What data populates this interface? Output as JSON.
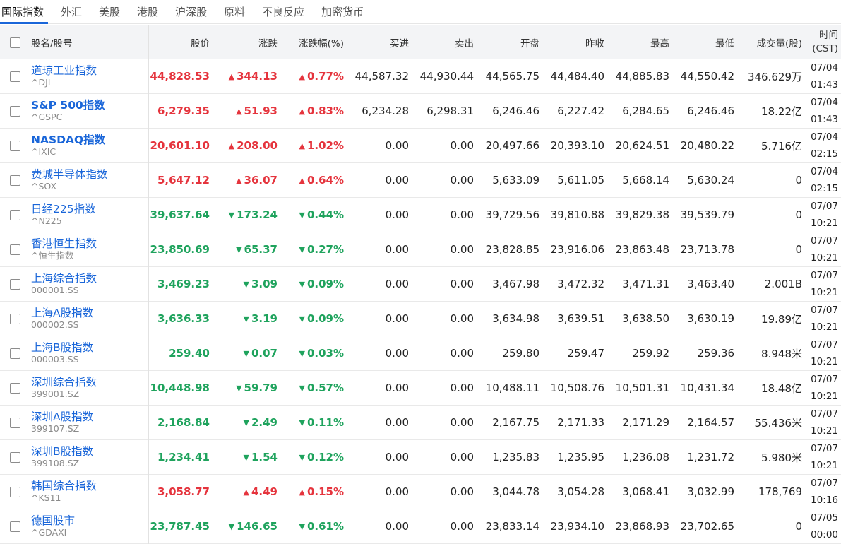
{
  "tabs": [
    {
      "label": "国际指数",
      "active": true
    },
    {
      "label": "外汇",
      "active": false
    },
    {
      "label": "美股",
      "active": false
    },
    {
      "label": "港股",
      "active": false
    },
    {
      "label": "沪深股",
      "active": false
    },
    {
      "label": "原料",
      "active": false
    },
    {
      "label": "不良反应",
      "active": false
    },
    {
      "label": "加密货币",
      "active": false
    }
  ],
  "columns": {
    "name": "股名/股号",
    "price": "股价",
    "change": "涨跌",
    "pct": "涨跌幅(%)",
    "bid": "买进",
    "ask": "卖出",
    "open": "开盘",
    "prev": "昨收",
    "high": "最高",
    "low": "最低",
    "volume": "成交量(股)",
    "time_line1": "时间",
    "time_line2": "(CST)"
  },
  "colors": {
    "up": "#e5343d",
    "down": "#1fa35d",
    "link": "#1a66d9"
  },
  "rows": [
    {
      "name": "道琼工业指数",
      "code": "^DJI",
      "bold": false,
      "dir": "up",
      "price": "44,828.53",
      "change": "344.13",
      "pct": "0.77%",
      "bid": "44,587.32",
      "ask": "44,930.44",
      "open": "44,565.75",
      "prev": "44,484.40",
      "high": "44,885.83",
      "low": "44,550.42",
      "volume": "346.629万",
      "date": "07/04",
      "time": "01:43"
    },
    {
      "name": "S&P 500指数",
      "code": "^GSPC",
      "bold": true,
      "dir": "up",
      "price": "6,279.35",
      "change": "51.93",
      "pct": "0.83%",
      "bid": "6,234.28",
      "ask": "6,298.31",
      "open": "6,246.46",
      "prev": "6,227.42",
      "high": "6,284.65",
      "low": "6,246.46",
      "volume": "18.22亿",
      "date": "07/04",
      "time": "01:43"
    },
    {
      "name": "NASDAQ指数",
      "code": "^IXIC",
      "bold": true,
      "dir": "up",
      "price": "20,601.10",
      "change": "208.00",
      "pct": "1.02%",
      "bid": "0.00",
      "ask": "0.00",
      "open": "20,497.66",
      "prev": "20,393.10",
      "high": "20,624.51",
      "low": "20,480.22",
      "volume": "5.716亿",
      "date": "07/04",
      "time": "02:15"
    },
    {
      "name": "费城半导体指数",
      "code": "^SOX",
      "bold": false,
      "dir": "up",
      "price": "5,647.12",
      "change": "36.07",
      "pct": "0.64%",
      "bid": "0.00",
      "ask": "0.00",
      "open": "5,633.09",
      "prev": "5,611.05",
      "high": "5,668.14",
      "low": "5,630.24",
      "volume": "0",
      "date": "07/04",
      "time": "02:15"
    },
    {
      "name": "日经225指数",
      "code": "^N225",
      "bold": false,
      "dir": "down",
      "price": "39,637.64",
      "change": "173.24",
      "pct": "0.44%",
      "bid": "0.00",
      "ask": "0.00",
      "open": "39,729.56",
      "prev": "39,810.88",
      "high": "39,829.38",
      "low": "39,539.79",
      "volume": "0",
      "date": "07/07",
      "time": "10:21"
    },
    {
      "name": "香港恒生指数",
      "code": "^恒生指数",
      "bold": false,
      "dir": "down",
      "price": "23,850.69",
      "change": "65.37",
      "pct": "0.27%",
      "bid": "0.00",
      "ask": "0.00",
      "open": "23,828.85",
      "prev": "23,916.06",
      "high": "23,863.48",
      "low": "23,713.78",
      "volume": "0",
      "date": "07/07",
      "time": "10:21"
    },
    {
      "name": "上海综合指数",
      "code": "000001.SS",
      "bold": false,
      "dir": "down",
      "price": "3,469.23",
      "change": "3.09",
      "pct": "0.09%",
      "bid": "0.00",
      "ask": "0.00",
      "open": "3,467.98",
      "prev": "3,472.32",
      "high": "3,471.31",
      "low": "3,463.40",
      "volume": "2.001B",
      "date": "07/07",
      "time": "10:21"
    },
    {
      "name": "上海A股指数",
      "code": "000002.SS",
      "bold": false,
      "dir": "down",
      "price": "3,636.33",
      "change": "3.19",
      "pct": "0.09%",
      "bid": "0.00",
      "ask": "0.00",
      "open": "3,634.98",
      "prev": "3,639.51",
      "high": "3,638.50",
      "low": "3,630.19",
      "volume": "19.89亿",
      "date": "07/07",
      "time": "10:21"
    },
    {
      "name": "上海B股指数",
      "code": "000003.SS",
      "bold": false,
      "dir": "down",
      "price": "259.40",
      "change": "0.07",
      "pct": "0.03%",
      "bid": "0.00",
      "ask": "0.00",
      "open": "259.80",
      "prev": "259.47",
      "high": "259.92",
      "low": "259.36",
      "volume": "8.948米",
      "date": "07/07",
      "time": "10:21"
    },
    {
      "name": "深圳综合指数",
      "code": "399001.SZ",
      "bold": false,
      "dir": "down",
      "price": "10,448.98",
      "change": "59.79",
      "pct": "0.57%",
      "bid": "0.00",
      "ask": "0.00",
      "open": "10,488.11",
      "prev": "10,508.76",
      "high": "10,501.31",
      "low": "10,431.34",
      "volume": "18.48亿",
      "date": "07/07",
      "time": "10:21"
    },
    {
      "name": "深圳A股指数",
      "code": "399107.SZ",
      "bold": false,
      "dir": "down",
      "price": "2,168.84",
      "change": "2.49",
      "pct": "0.11%",
      "bid": "0.00",
      "ask": "0.00",
      "open": "2,167.75",
      "prev": "2,171.33",
      "high": "2,171.29",
      "low": "2,164.57",
      "volume": "55.436米",
      "date": "07/07",
      "time": "10:21"
    },
    {
      "name": "深圳B股指数",
      "code": "399108.SZ",
      "bold": false,
      "dir": "down",
      "price": "1,234.41",
      "change": "1.54",
      "pct": "0.12%",
      "bid": "0.00",
      "ask": "0.00",
      "open": "1,235.83",
      "prev": "1,235.95",
      "high": "1,236.08",
      "low": "1,231.72",
      "volume": "5.980米",
      "date": "07/07",
      "time": "10:21"
    },
    {
      "name": "韩国综合指数",
      "code": "^KS11",
      "bold": false,
      "dir": "up",
      "price": "3,058.77",
      "change": "4.49",
      "pct": "0.15%",
      "bid": "0.00",
      "ask": "0.00",
      "open": "3,044.78",
      "prev": "3,054.28",
      "high": "3,068.41",
      "low": "3,032.99",
      "volume": "178,769",
      "date": "07/07",
      "time": "10:16"
    },
    {
      "name": "德国股市",
      "code": "^GDAXI",
      "bold": false,
      "dir": "down",
      "price": "23,787.45",
      "change": "146.65",
      "pct": "0.61%",
      "bid": "0.00",
      "ask": "0.00",
      "open": "23,833.14",
      "prev": "23,934.10",
      "high": "23,868.93",
      "low": "23,702.65",
      "volume": "0",
      "date": "07/05",
      "time": "00:00"
    }
  ]
}
